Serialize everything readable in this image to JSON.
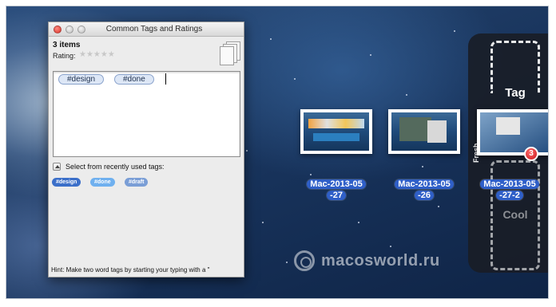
{
  "window": {
    "title": "Common Tags and Ratings",
    "item_count": "3 items",
    "rating_label": "Rating:",
    "rating_stars": "★★★★★",
    "rating_value": 0,
    "tags": [
      "#design",
      "#done"
    ],
    "recent_label": "Select from recently used tags:",
    "recent_tags": [
      "#design",
      "#done",
      "#draft"
    ],
    "hint": "Hint: Make two word tags by starting your typing with a \""
  },
  "desktop": {
    "files": [
      {
        "name_line1": "Mac-2013-05",
        "name_line2": "-27"
      },
      {
        "name_line1": "Mac-2013-05",
        "name_line2": "-26"
      },
      {
        "name_line1": "Mac-2013-05",
        "name_line2": "-27-2"
      }
    ],
    "badge_count": "3"
  },
  "tag_panel": {
    "tag_word": "Tag",
    "cool_word": "Cool",
    "fresh_word": "Fresh"
  },
  "watermark": {
    "text": "macosworld.ru"
  },
  "colors": {
    "accent_blue": "#2f5fc8",
    "badge_red": "#c8161b",
    "close_red": "#d9342b"
  }
}
